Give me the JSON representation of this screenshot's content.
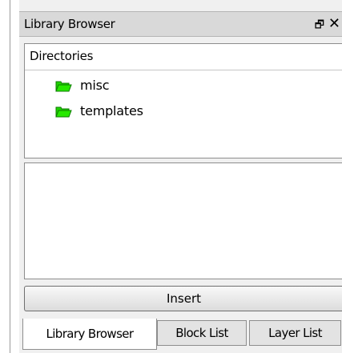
{
  "window": {
    "title": "Library Browser",
    "float_icon": "float-restore-icon",
    "close_icon": "close-icon"
  },
  "directories": {
    "header": "Directories",
    "items": [
      {
        "label": "misc",
        "icon": "folder-icon"
      },
      {
        "label": "templates",
        "icon": "folder-icon"
      }
    ]
  },
  "insert_button": {
    "label": "Insert"
  },
  "tabs": [
    {
      "label": "Library Browser",
      "active": true
    },
    {
      "label": "Block List",
      "active": false
    },
    {
      "label": "Layer List",
      "active": false
    }
  ],
  "colors": {
    "folder": "#1fd400",
    "folder_outline": "#0e7a00"
  }
}
